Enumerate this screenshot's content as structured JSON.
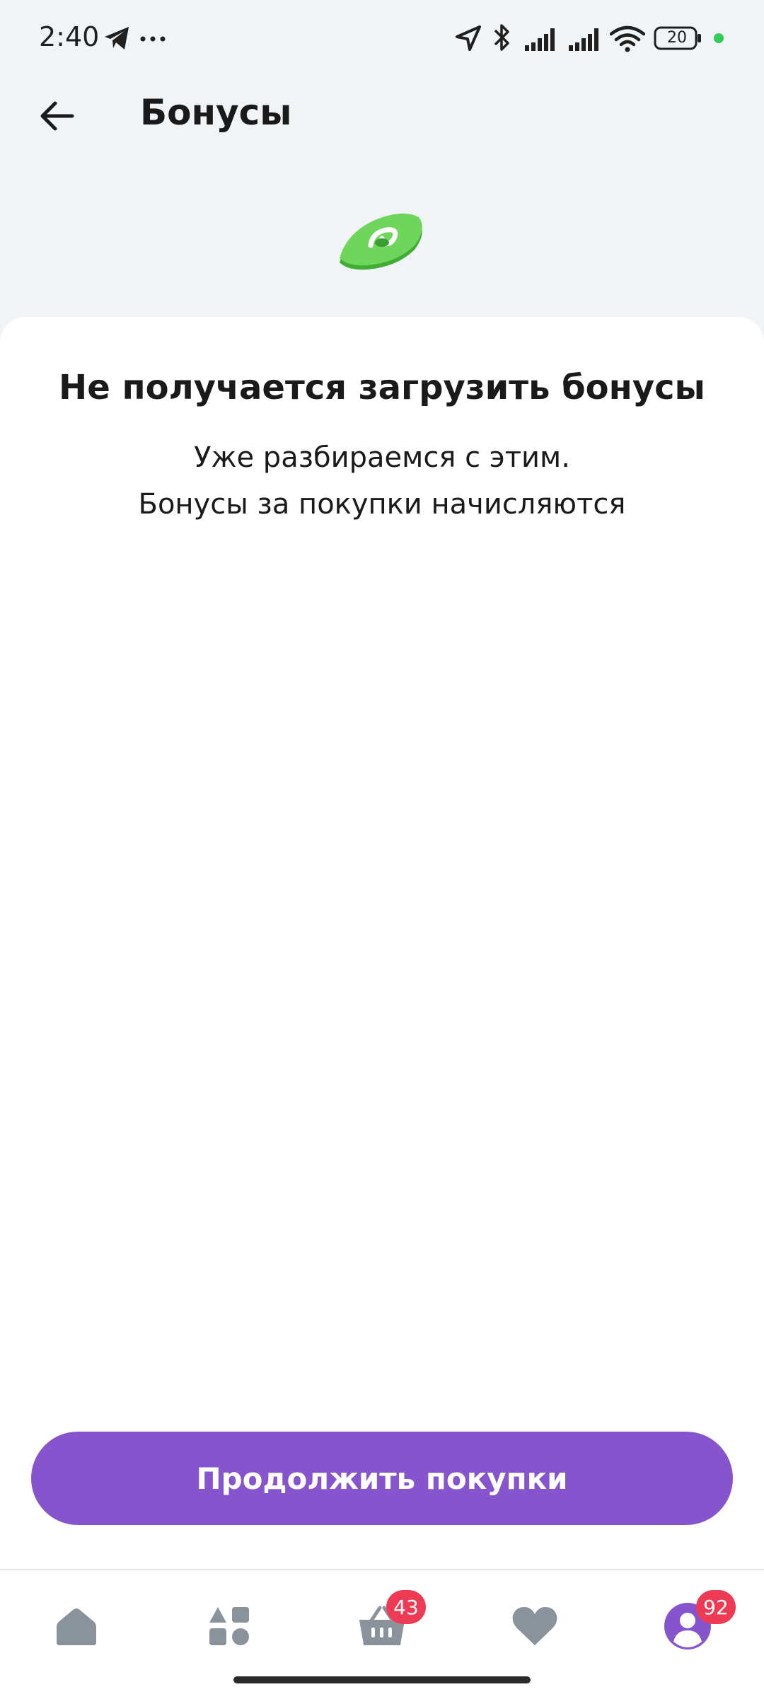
{
  "status_bar": {
    "time": "2:40",
    "battery": "20"
  },
  "header": {
    "title": "Бонусы"
  },
  "error": {
    "title": "Не получается загрузить бонусы",
    "line1": "Уже разбираемся с этим.",
    "line2": "Бонусы за покупки начисляются"
  },
  "actions": {
    "continue_label": "Продолжить покупки"
  },
  "bottom_nav": {
    "cart_badge": "43",
    "profile_badge": "92"
  },
  "colors": {
    "accent": "#8654cc",
    "badge": "#ee3b55",
    "icon_gray": "#8a929c",
    "illustration_green": "#5ecb4a"
  }
}
